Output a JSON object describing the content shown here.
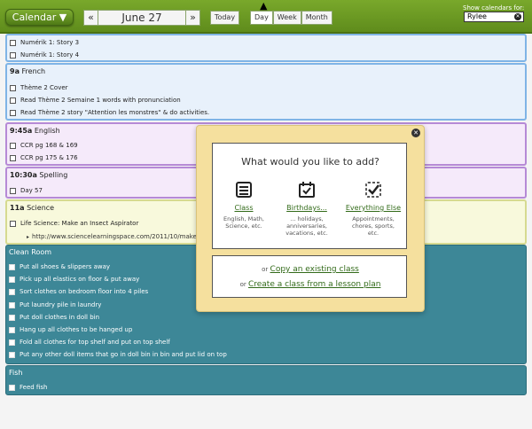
{
  "header": {
    "calendar_button": "Calendar ▼",
    "prev_arrow": "«",
    "date": "June 27",
    "next_arrow": "»",
    "today": "Today",
    "views": [
      "Day",
      "Week",
      "Month"
    ],
    "active_view": "Day",
    "show_label": "Show calendars for:",
    "selected_calendar": "Rylee"
  },
  "events": {
    "numerik": {
      "items": [
        "Numérik 1: Story 3",
        "Numérik 1: Story 4"
      ]
    },
    "french": {
      "time": "9a",
      "name": "French",
      "items": [
        "Thème 2 Cover",
        "Read Thème 2 Semaine 1 words with pronunciation",
        "Read Thème 2 story \"Attention les monstres\" & do activities."
      ]
    },
    "english": {
      "time": "9:45a",
      "name": "English",
      "items": [
        "CCR pg 168 & 169",
        "CCR pg 175 & 176"
      ]
    },
    "spelling": {
      "time": "10:30a",
      "name": "Spelling",
      "items": [
        "Day 57"
      ]
    },
    "science": {
      "time": "11a",
      "name": "Science",
      "items": [
        "Life Science: Make an Insect Aspirator"
      ],
      "link": "http://www.sciencelearningspace.com/2011/10/make"
    },
    "clean_room": {
      "name": "Clean Room",
      "items": [
        "Put all shoes & slippers away",
        "Pick up all elastics on floor & put away",
        "Sort clothes on bedroom floor into 4 piles",
        "Put laundry pile in laundry",
        "Put doll clothes in doll bin",
        "Hang up all clothes to be hanged up",
        "Fold all clothes for top shelf and put on top shelf",
        "Put any other doll items that go in doll bin in bin and put lid on top"
      ]
    },
    "fish": {
      "name": "Fish",
      "items": [
        "Feed fish"
      ]
    }
  },
  "modal": {
    "question": "What would you like to add?",
    "options": [
      {
        "label": "Class",
        "sub": [
          "English, Math,",
          "Science, etc."
        ]
      },
      {
        "label": "Birthdays...",
        "sub": [
          "... holidays,",
          "anniversaries,",
          "vacations, etc."
        ]
      },
      {
        "label": "Everything Else",
        "sub": [
          "Appointments,",
          "chores, sports,",
          "etc."
        ]
      }
    ],
    "copy_prefix": "or",
    "copy_link": "Copy an existing class",
    "create_prefix": "or",
    "create_link": "Create a class from a lesson plan"
  }
}
